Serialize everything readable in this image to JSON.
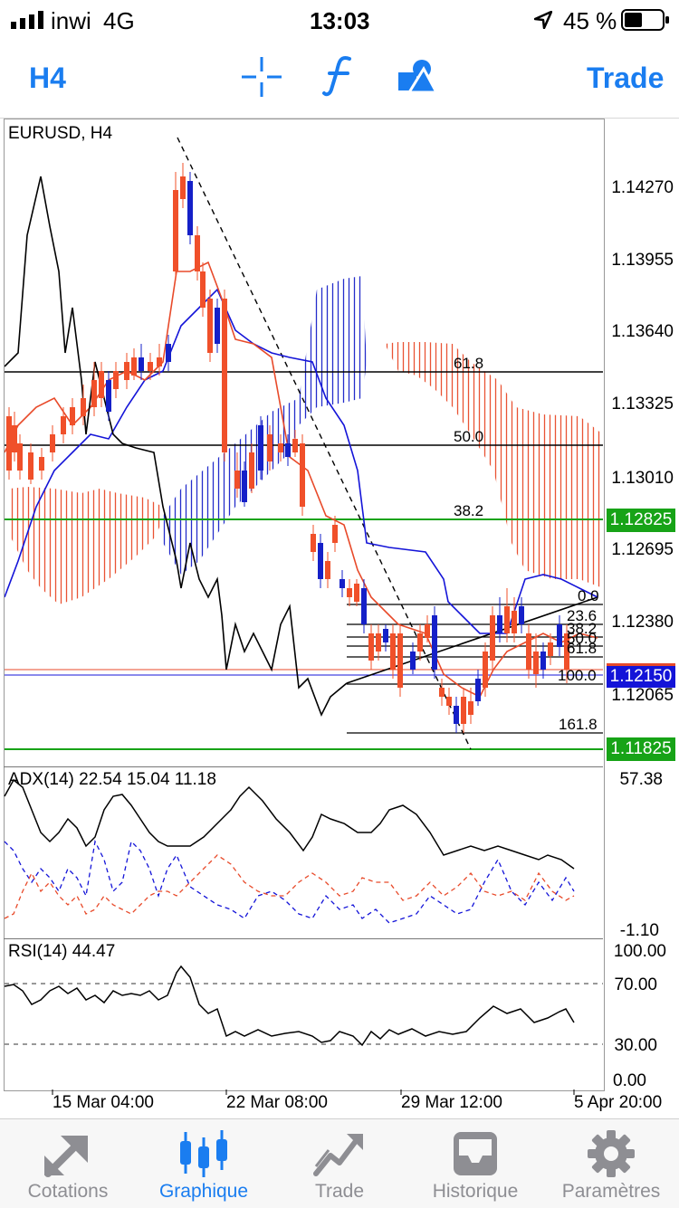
{
  "status_bar": {
    "carrier": "inwi",
    "network": "4G",
    "time": "13:03",
    "battery": "45 %"
  },
  "toolbar": {
    "timeframe": "H4",
    "trade_label": "Trade",
    "icons": [
      "crosshair-icon",
      "function-icon",
      "objects-icon"
    ]
  },
  "chart": {
    "symbol_title": "EURUSD, H4",
    "price_axis": [
      "1.14270",
      "1.13955",
      "1.13640",
      "1.13325",
      "1.13010",
      "1.12695",
      "1.12380",
      "1.12065"
    ],
    "badges": {
      "green_top": "1.12825",
      "blue_bid": "1.12150",
      "green_bottom": "1.11825"
    },
    "fib_levels": [
      "61.8",
      "50.0",
      "38.2",
      "0.0",
      "23.6",
      "38.2",
      "50.0",
      "61.8",
      "100.0",
      "161.8"
    ],
    "time_axis": [
      "15 Mar 04:00",
      "22 Mar 08:00",
      "29 Mar 12:00",
      "5 Apr 20:00"
    ]
  },
  "adx_pane": {
    "title": "ADX(14) 22.54 15.04 11.18",
    "max_label": "57.38",
    "min_label": "-1.10"
  },
  "rsi_pane": {
    "title": "RSI(14) 44.47",
    "levels": [
      "100.00",
      "70.00",
      "30.00",
      "0.00"
    ]
  },
  "tab_bar": {
    "tabs": [
      {
        "label": "Cotations",
        "icon": "quotes-arrows-icon"
      },
      {
        "label": "Graphique",
        "icon": "candlestick-chart-icon"
      },
      {
        "label": "Trade",
        "icon": "trade-chart-icon"
      },
      {
        "label": "Historique",
        "icon": "history-inbox-icon"
      },
      {
        "label": "Paramètres",
        "icon": "gear-icon"
      }
    ],
    "active": "Graphique"
  },
  "colors": {
    "accent": "#1a7df0",
    "bull": "#1520c8",
    "bear": "#f0502a",
    "green_line": "#17a317",
    "blue_badge": "#1414d8"
  }
}
